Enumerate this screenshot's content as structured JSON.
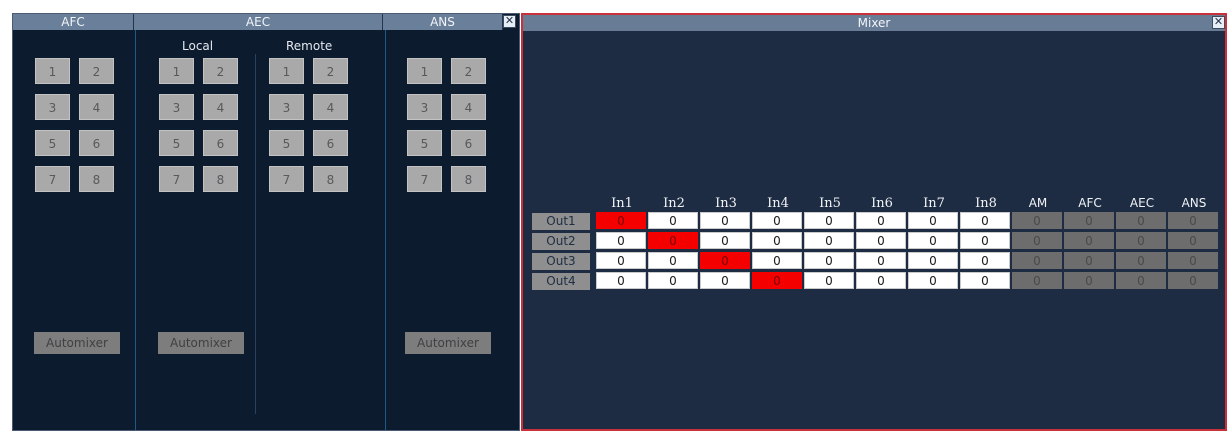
{
  "left_panel": {
    "afc": {
      "title": "AFC",
      "buttons": [
        "1",
        "2",
        "3",
        "4",
        "5",
        "6",
        "7",
        "8"
      ],
      "automixer_label": "Automixer"
    },
    "aec": {
      "title": "AEC",
      "local": {
        "label": "Local",
        "buttons": [
          "1",
          "2",
          "3",
          "4",
          "5",
          "6",
          "7",
          "8"
        ],
        "automixer_label": "Automixer"
      },
      "remote": {
        "label": "Remote",
        "buttons": [
          "1",
          "2",
          "3",
          "4",
          "5",
          "6",
          "7",
          "8"
        ]
      }
    },
    "ans": {
      "title": "ANS",
      "buttons": [
        "1",
        "2",
        "3",
        "4",
        "5",
        "6",
        "7",
        "8"
      ],
      "automixer_label": "Automixer"
    },
    "close_glyph": "✕"
  },
  "mixer": {
    "title": "Mixer",
    "close_glyph": "✕",
    "columns": [
      "In1",
      "In2",
      "In3",
      "In4",
      "In5",
      "In6",
      "In7",
      "In8",
      "AM",
      "AFC",
      "AEC",
      "ANS"
    ],
    "rows": [
      {
        "label": "Out1",
        "values": [
          "0",
          "0",
          "0",
          "0",
          "0",
          "0",
          "0",
          "0",
          "0",
          "0",
          "0",
          "0"
        ],
        "active_col": 0
      },
      {
        "label": "Out2",
        "values": [
          "0",
          "0",
          "0",
          "0",
          "0",
          "0",
          "0",
          "0",
          "0",
          "0",
          "0",
          "0"
        ],
        "active_col": 1
      },
      {
        "label": "Out3",
        "values": [
          "0",
          "0",
          "0",
          "0",
          "0",
          "0",
          "0",
          "0",
          "0",
          "0",
          "0",
          "0"
        ],
        "active_col": 2
      },
      {
        "label": "Out4",
        "values": [
          "0",
          "0",
          "0",
          "0",
          "0",
          "0",
          "0",
          "0",
          "0",
          "0",
          "0",
          "0"
        ],
        "active_col": 3
      }
    ],
    "disabled_cols": [
      8,
      9,
      10,
      11
    ]
  },
  "colors": {
    "panel_bg": "#0d1b2e",
    "mixer_bg": "#1d2c42",
    "active_cell": "#f40000",
    "mixer_border": "#c8303a"
  }
}
